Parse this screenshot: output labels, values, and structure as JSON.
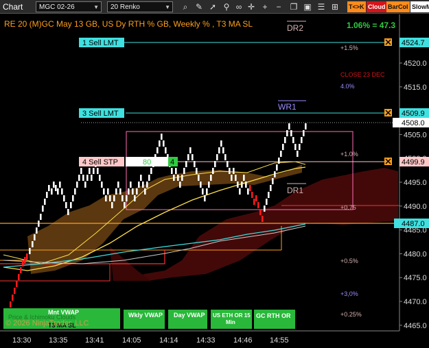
{
  "toolbar": {
    "title": "Chart",
    "instrument": "MGC 02-26",
    "bar_type": "20 Renko",
    "icons": [
      "magnifier-icon",
      "pencil-icon",
      "cursor-icon",
      "pin-icon",
      "link-icon",
      "crosshair-icon",
      "plus-icon",
      "minus-icon",
      "copy-icon",
      "text-icon"
    ],
    "buttons": [
      "T<>K",
      "Cloud",
      "BarCol",
      "SlowM"
    ],
    "button_colors": [
      "#ff8c1a",
      "#d4141a",
      "#ff8c1a",
      "#ffffff"
    ]
  },
  "header": {
    "info": "RE 20  (M)GC May 13 GB, US Dy RTH % GB, Weekly % , T3 MA SL",
    "pct": "1.06% = 47.3",
    "pct_color": "#2ecc40",
    "info_color": "#ff9f1c"
  },
  "orders": [
    {
      "label": "1 Sell LMT",
      "price": "4524.7",
      "bg": "#40e0e0"
    },
    {
      "label": "3 Sell LMT",
      "price": "4509.9",
      "bg": "#40e0e0"
    },
    {
      "label": "4 Sell STP",
      "price": "4499.9",
      "bg": "#ffc8c8",
      "qty": "80",
      "count": "4"
    }
  ],
  "price_axis": {
    "ticks": [
      "4520.0",
      "4515.0",
      "4510.0",
      "4505.0",
      "4500.0",
      "4495.0",
      "4490.0",
      "4485.0",
      "4480.0",
      "4475.0",
      "4470.0",
      "4465.0"
    ],
    "last_price": "4508.0",
    "marker_4487": "4487.0"
  },
  "annotations": {
    "dr2": "DR2",
    "wr1": "WR1",
    "dr1": "DR1",
    "p15": "+1.5%",
    "close": "CLOSE 23 DEC",
    "p40": "4.0%",
    "p10": "+1.0%",
    "p075": "+0.75",
    "p05": "+0.5%",
    "p30": "+3,0%",
    "p025": "+0.25%"
  },
  "time_axis": [
    "13:30",
    "13:35",
    "13:41",
    "14:05",
    "14:14",
    "14:33",
    "14:46",
    "14:55"
  ],
  "footer_buttons": [
    {
      "label": "Mnt VWAP",
      "sub": "T3 MA SL"
    },
    {
      "label": "Wkly VWAP",
      "sub": ""
    },
    {
      "label": "Day VWAP",
      "sub": ""
    },
    {
      "label": "US ETH OR 15 Min",
      "sub": ""
    },
    {
      "label": "GC RTH OR",
      "sub": ""
    }
  ],
  "footer_ghost": "Price & Ichimoku Clouds",
  "copyright": "© 2026 NinjaTrader, LLC"
}
